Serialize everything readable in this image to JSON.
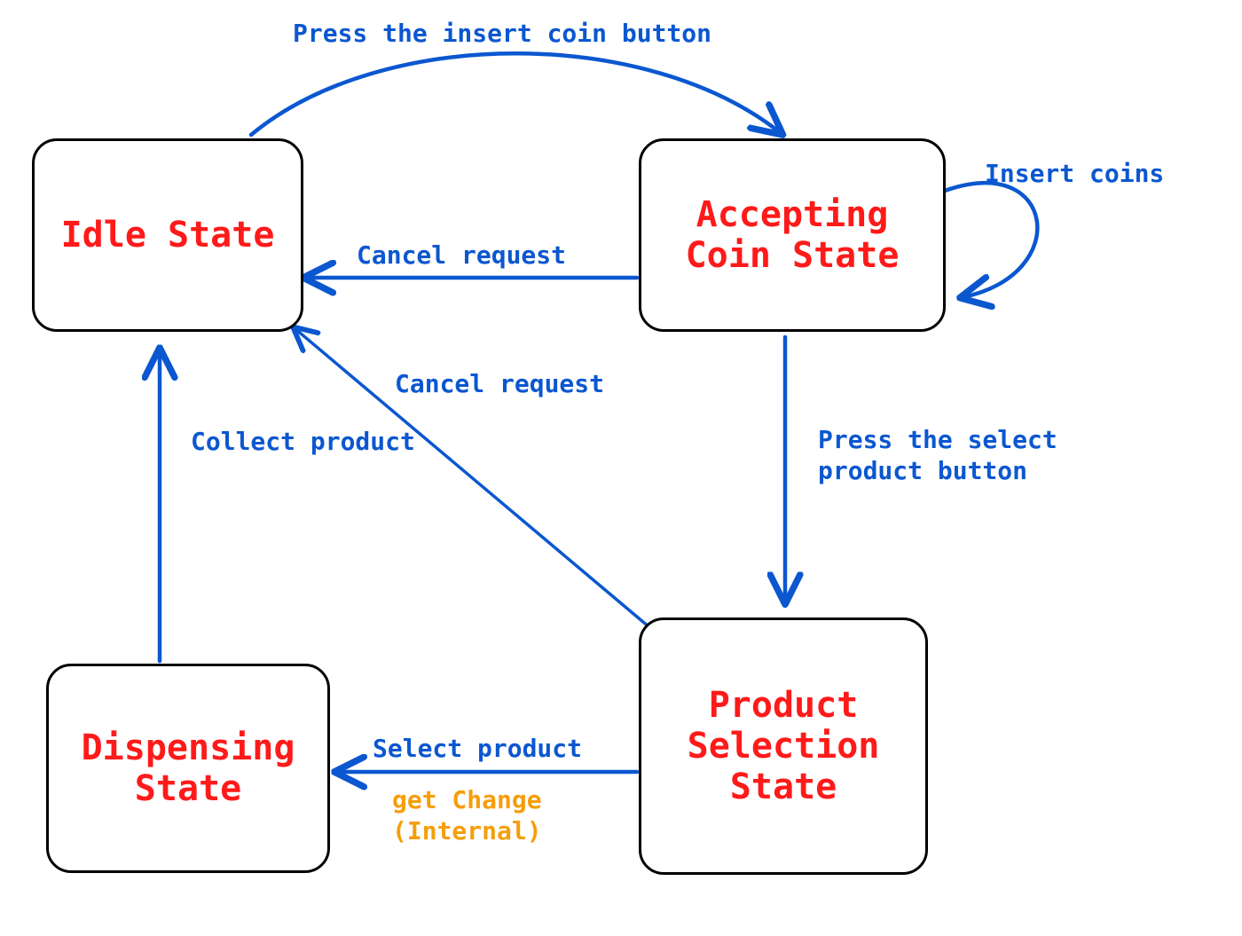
{
  "colors": {
    "state_text": "#ff1a1a",
    "edge": "#0b57d0",
    "internal": "#f59e0b",
    "node_border": "#000000",
    "background": "#ffffff"
  },
  "states": {
    "idle": {
      "label": "Idle State"
    },
    "accepting": {
      "label": "Accepting\nCoin State"
    },
    "product": {
      "label": "Product\nSelection\nState"
    },
    "dispensing": {
      "label": "Dispensing\nState"
    }
  },
  "transitions": {
    "idle_to_accepting": {
      "label": "Press the insert coin button"
    },
    "accepting_self": {
      "label": "Insert coins"
    },
    "accepting_to_idle": {
      "label": "Cancel request"
    },
    "accepting_to_product": {
      "label": "Press the select\nproduct button"
    },
    "product_to_idle": {
      "label": "Cancel request"
    },
    "product_to_dispensing": {
      "label": "Select product",
      "internal": "get Change\n(Internal)"
    },
    "dispensing_to_idle": {
      "label": "Collect product"
    }
  }
}
